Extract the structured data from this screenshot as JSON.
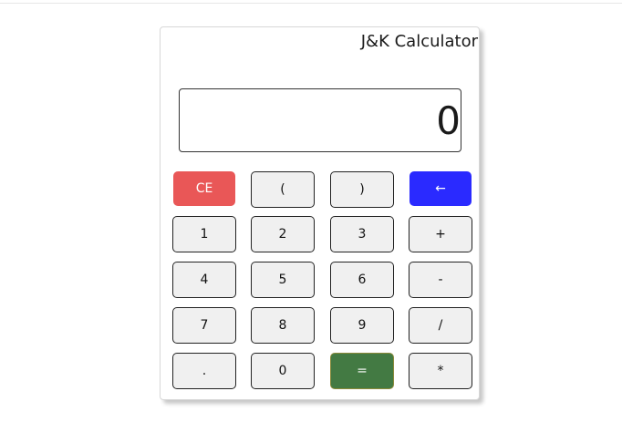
{
  "app": {
    "title": "J&K Calculator"
  },
  "display": {
    "value": "0"
  },
  "keys": {
    "ce": "CE",
    "open_paren": "(",
    "close_paren": ")",
    "backspace": "←",
    "k1": "1",
    "k2": "2",
    "k3": "3",
    "plus": "+",
    "k4": "4",
    "k5": "5",
    "k6": "6",
    "minus": "-",
    "k7": "7",
    "k8": "8",
    "k9": "9",
    "divide": "/",
    "dot": ".",
    "k0": "0",
    "equals": "=",
    "multiply": "*"
  },
  "colors": {
    "clear": "#e95757",
    "backspace": "#2a2aff",
    "equals": "#437a43",
    "key": "#f0f0f0"
  }
}
